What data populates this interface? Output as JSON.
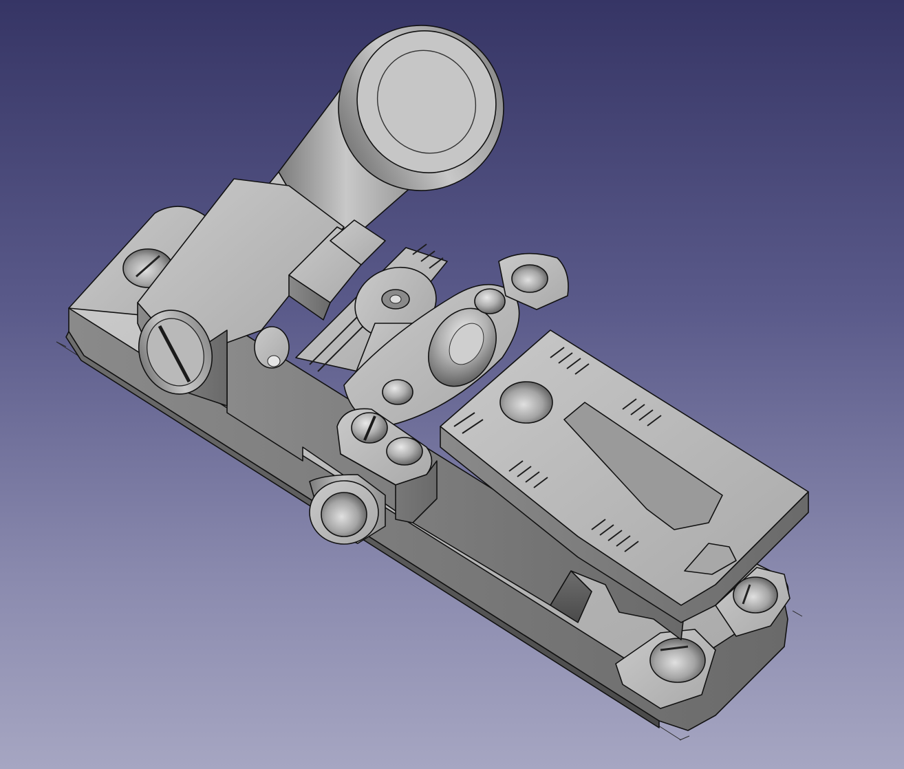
{
  "app": {
    "window": "3D view"
  },
  "viewport": {
    "background_top": "#363565",
    "background_bottom": "#a6a6c2",
    "model_color": "#b8b8b8",
    "edge_color": "#111111"
  },
  "model": {
    "icon": "cad-part-icon"
  }
}
